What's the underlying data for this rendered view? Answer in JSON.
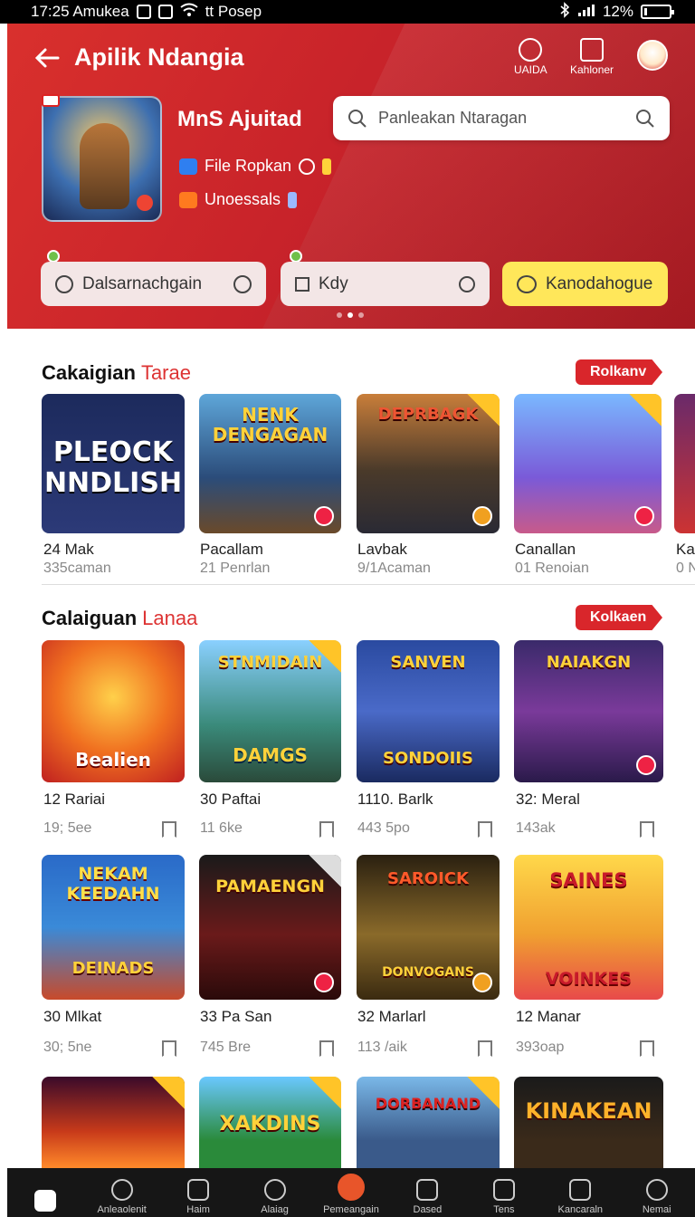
{
  "status_bar": {
    "time_carrier": "17:25 Amukea",
    "network": "tt Posep",
    "battery": "12%",
    "battery_level": 0.12
  },
  "header": {
    "title": "Apilik Ndangia",
    "actions": [
      {
        "label": "UAIDA",
        "icon": "bulb-icon"
      },
      {
        "label": "Kahloner",
        "icon": "cart-icon"
      }
    ],
    "app_name": "MnS Ajuitad",
    "meta_1": "File Ropkan",
    "meta_2": "Unoessals",
    "search_placeholder": "Panleakan Ntaragan",
    "pills": [
      "Dalsarnachgain",
      "Kdy",
      "Kanodahogue"
    ],
    "page_index": 1,
    "page_count": 3
  },
  "section1": {
    "title_bold": "Cakaigian",
    "title_accent": "Tarae",
    "button": "Rolkanv",
    "cards": [
      {
        "title": "24 Mak",
        "sub": "335caman",
        "art": "PLEOCK NNDLISH"
      },
      {
        "title": "Pacallam",
        "sub": "21 Penrlan",
        "art": "NENK DENGAGAN"
      },
      {
        "title": "Lavbak",
        "sub": "9/1Acaman",
        "art": "DEPRBAGK"
      },
      {
        "title": "Canallan",
        "sub": "01 Renoian",
        "art": ""
      },
      {
        "title": "Ka",
        "sub": "0 N",
        "art": ""
      }
    ]
  },
  "section2": {
    "title_bold": "Calaiguan",
    "title_accent": "Lanaa",
    "button": "Kolkaen",
    "cards": [
      {
        "title": "12 Rariai",
        "sub": "19; 5ee",
        "art_top": "",
        "art_bottom": "Bealien"
      },
      {
        "title": "30 Paftai",
        "sub": "11 6ke",
        "art_top": "STNMIDAIN",
        "art_bottom": "DAMGS"
      },
      {
        "title": "1110. Barlk",
        "sub": "443 5po",
        "art_top": "SANVEN",
        "art_bottom": "SONDOIIS"
      },
      {
        "title": "32: Meral",
        "sub": "143ak",
        "art_top": "NAIAKGN",
        "art_bottom": ""
      },
      {
        "title": "30 Mlkat",
        "sub": "30; 5ne",
        "art_top": "NEKAM KEEDAHN",
        "art_bottom": "DEINADS"
      },
      {
        "title": "33 Pa San",
        "sub": "745 Bre",
        "art_top": "PAMAENGN",
        "art_bottom": ""
      },
      {
        "title": "32 Marlarl",
        "sub": "113 /aik",
        "art_top": "SAROICK",
        "art_bottom": "DONVOGANS"
      },
      {
        "title": "12 Manar",
        "sub": "393oap",
        "art_top": "SAINES",
        "art_bottom": "VOINKES"
      }
    ],
    "row3_art": [
      "",
      "XAKDINS",
      "DORBANAND",
      "KINAKEAN"
    ]
  },
  "bottom_nav": [
    {
      "label": "",
      "icon": "home-icon"
    },
    {
      "label": "Anleaolenit",
      "icon": "search-icon"
    },
    {
      "label": "Haim",
      "icon": "house-icon"
    },
    {
      "label": "Alaiag",
      "icon": "magnify-icon"
    },
    {
      "label": "Pemeangain",
      "icon": "mascot-icon"
    },
    {
      "label": "Dased",
      "icon": "bookmark-icon"
    },
    {
      "label": "Tens",
      "icon": "news-icon"
    },
    {
      "label": "Kancaraln",
      "icon": "cart-icon"
    },
    {
      "label": "Nemai",
      "icon": "profile-icon"
    }
  ],
  "colors": {
    "brand_red": "#d9262b",
    "accent_yellow": "#ffe75a",
    "nav_bg": "#161616"
  }
}
